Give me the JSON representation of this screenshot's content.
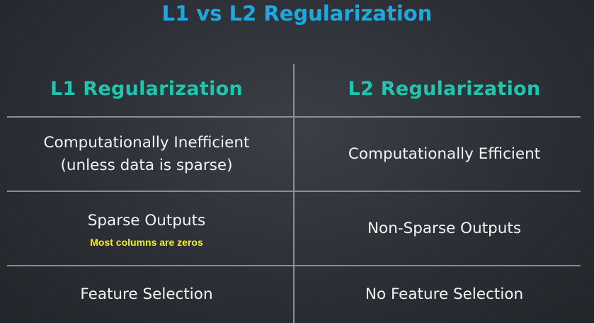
{
  "title": "L1 vs L2 Regularization",
  "headers": [
    "L1 Regularization",
    "L2 Regularization"
  ],
  "rows": [
    {
      "left": [
        "Computationally Inefficient",
        "(unless data is sparse)"
      ],
      "right": [
        "Computationally Efficient"
      ]
    },
    {
      "left": [
        "Sparse Outputs"
      ],
      "left_note": "Most columns are zeros",
      "right": [
        "Non-Sparse Outputs"
      ]
    },
    {
      "left": [
        "Feature Selection"
      ],
      "right": [
        "No Feature Selection"
      ]
    }
  ],
  "colors": {
    "title": "#1fa8e0",
    "header": "#1ec6b0",
    "body_text": "#f2f3f4",
    "note": "#f5ef1a",
    "divider": "#8a8f96",
    "background": "#2c3036"
  }
}
